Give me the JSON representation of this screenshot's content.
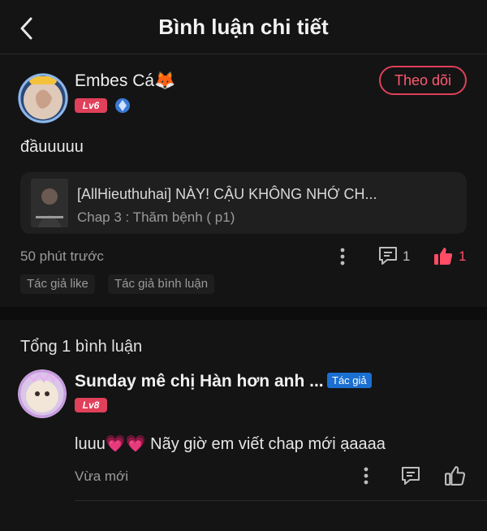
{
  "header": {
    "title": "Bình luận chi tiết"
  },
  "comment": {
    "user_name": "Embes Cá🦊",
    "level": "Lv6",
    "follow_label": "Theo dõi",
    "text": "đầuuuuu",
    "chapter": {
      "title": "[AllHieuthuhai] NÀY! CẬU KHÔNG NHỚ CH...",
      "subtitle": "Chap 3 : Thăm bệnh ( p1)"
    },
    "time": "50 phút trước",
    "reply_count": "1",
    "like_count": "1",
    "tags": [
      "Tác giả like",
      "Tác giả bình luận"
    ]
  },
  "replies_section": {
    "total_label": "Tổng 1 bình luận"
  },
  "reply": {
    "user_name": "Sunday mê chị Hàn hơn anh ...",
    "author_badge": "Tác giả",
    "level": "Lv8",
    "text": "luuu💗💗 Nãy giờ em viết chap mới ạaaaa",
    "time": "Vừa mới"
  },
  "colors": {
    "accent": "#e0405a",
    "author_badge": "#1a6fd0",
    "background": "#141414"
  }
}
